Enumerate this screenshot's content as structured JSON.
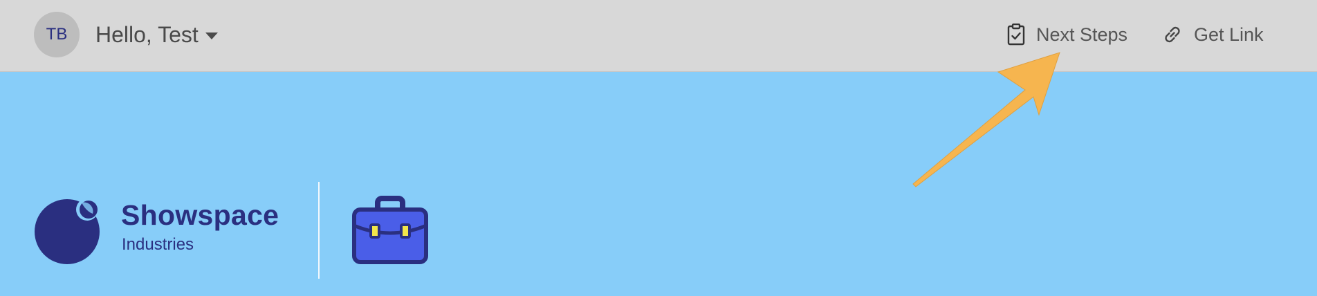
{
  "header": {
    "avatar_initials": "TB",
    "greeting": "Hello, Test",
    "actions": {
      "next_steps": {
        "label": "Next Steps",
        "icon": "clipboard-check-icon"
      },
      "get_link": {
        "label": "Get Link",
        "icon": "link-icon"
      }
    }
  },
  "brand": {
    "name": "Showspace",
    "subtitle": "Industries",
    "color": "#2a2f80"
  },
  "colors": {
    "topbar": "#d8d8d8",
    "background": "#87cdf9",
    "annotation_arrow": "#f6b54f",
    "briefcase_fill": "#4a5ee8",
    "briefcase_stroke": "#2a2f80"
  }
}
